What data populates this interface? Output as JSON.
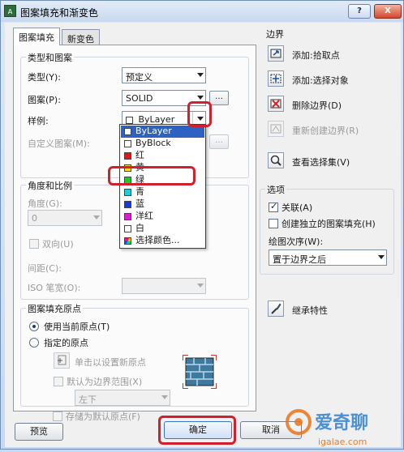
{
  "window": {
    "title": "图案填充和渐变色",
    "app_icon": "AutoCAD-icon",
    "help_label": "?",
    "close_label": "X"
  },
  "tabs": [
    {
      "label": "图案填充",
      "active": true
    },
    {
      "label": "新变色",
      "active": false
    }
  ],
  "type_group": {
    "title": "类型和图案",
    "type_label": "类型(Y):",
    "type_value": "预定义",
    "pattern_label": "图案(P):",
    "pattern_value": "SOLID",
    "swatch_label": "样例:",
    "swatch_value": "ByLayer",
    "custom_label": "自定义图案(M):"
  },
  "angle_group": {
    "title": "角度和比例",
    "angle_label": "角度(G):",
    "angle_value": "0",
    "double_label": "双向(U)",
    "spacing_label": "间距(C):",
    "iso_label": "ISO 笔宽(O):"
  },
  "color_dropdown": {
    "items": [
      {
        "label": "ByLayer",
        "color": "#ffffff"
      },
      {
        "label": "ByBlock",
        "color": "#ffffff"
      },
      {
        "label": "红",
        "color": "#e0161d"
      },
      {
        "label": "黄",
        "color": "#f5e21a"
      },
      {
        "label": "绿",
        "color": "#1fc92d"
      },
      {
        "label": "青",
        "color": "#1ecbd4"
      },
      {
        "label": "蓝",
        "color": "#1a39d6"
      },
      {
        "label": "洋红",
        "color": "#d71ed0"
      },
      {
        "label": "白",
        "color": "#ffffff"
      },
      {
        "label": "选择颜色...",
        "color": "#7aa0d4"
      }
    ]
  },
  "origin_group": {
    "title": "图案填充原点",
    "use_current_label": "使用当前原点(T)",
    "specified_label": "指定的原点",
    "click_set_label": "单击以设置新原点",
    "default_extent_label": "默认为边界范围(X)",
    "position_value": "左下",
    "store_default_label": "存储为默认原点(F)"
  },
  "boundary": {
    "title": "边界",
    "add_pick_label": "添加:拾取点",
    "add_select_label": "添加:选择对象",
    "remove_label": "删除边界(D)",
    "recreate_label": "重新创建边界(R)",
    "view_select_label": "查看选择集(V)"
  },
  "options": {
    "title": "选项",
    "associative_label": "关联(A)",
    "separate_label": "创建独立的图案填充(H)",
    "draw_order_label": "绘图次序(W):",
    "draw_order_value": "置于边界之后"
  },
  "inherit_label": "继承特性",
  "footer": {
    "preview_label": "预览",
    "ok_label": "确定",
    "cancel_label": "取消"
  },
  "watermark": {
    "text": "爱奇聊",
    "subtext": "igalae.com"
  },
  "colors": {
    "highlight": "#d21f2e",
    "selection": "#2e62c2"
  }
}
